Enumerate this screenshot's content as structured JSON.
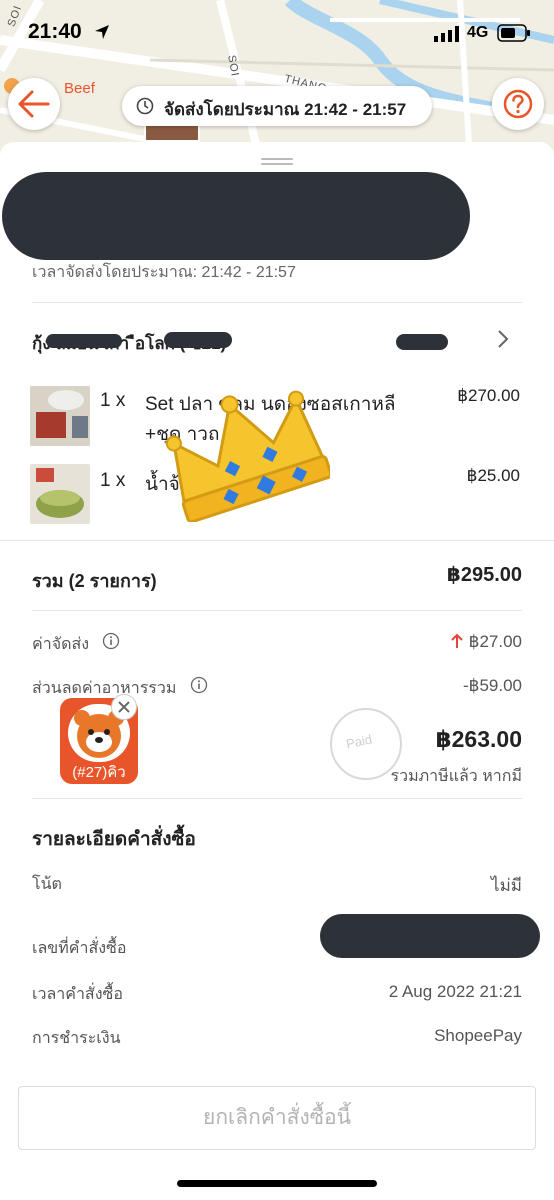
{
  "status_bar": {
    "time": "21:40",
    "network": "4G",
    "icons": [
      "location-arrow-icon",
      "signal-bars-icon",
      "battery-icon"
    ]
  },
  "map": {
    "labels": [
      "SOI",
      "SOI",
      "THANO"
    ],
    "restaurant_label": "Beef"
  },
  "header": {
    "eta_pill": "จัดส่งโดยประมาณ 21:42 - 21:57",
    "icons": [
      "back-arrow-icon",
      "clock-icon",
      "help-icon"
    ]
  },
  "order": {
    "estimated_delivery": "เวลาจัดส่งโดยประมาณ: 21:42 - 21:57",
    "restaurant_name": "กุ้ง                 ลมอน              เกา           ือโลก (             ข21)",
    "items": [
      {
        "qty": "1 x",
        "name": "Set ปลา      ซลม      นดองซอสเกาหลี +ชุด      าวถ",
        "price": "฿270.00"
      },
      {
        "qty": "1 x",
        "name": "น้ำจ้              ออนซ์",
        "price": "฿25.00"
      }
    ],
    "subtotal_label": "รวม (2 รายการ)",
    "subtotal_value": "฿295.00",
    "delivery_fee_label": "ค่าจัดส่ง",
    "delivery_fee_value": "฿27.00",
    "discount_label": "ส่วนลดค่าอาหารรวม",
    "discount_value": "-฿59.00",
    "total_value": "฿263.00",
    "total_note": "รวมภาษีแล้ว หากมี",
    "paid_stamp": "Paid",
    "rider_label": "(#27)คิว"
  },
  "details": {
    "title": "รายละเอียดคำสั่งซื้อ",
    "rows": [
      {
        "label": "โน้ต",
        "value": "ไม่มี"
      },
      {
        "label": "เลขที่คำสั่งซื้อ",
        "value": ""
      },
      {
        "label": "เวลาคำสั่งซื้อ",
        "value": "2 Aug 2022 21:21"
      },
      {
        "label": "การชำระเงิน",
        "value": "ShopeePay"
      }
    ]
  },
  "cancel_button": "ยกเลิกคำสั่งซื้อนี้",
  "colors": {
    "accent": "#e8552a",
    "up_arrow": "#e8433a",
    "redaction": "#2c3237",
    "map_road": "#ffffff",
    "map_water": "#a9d3ee"
  }
}
